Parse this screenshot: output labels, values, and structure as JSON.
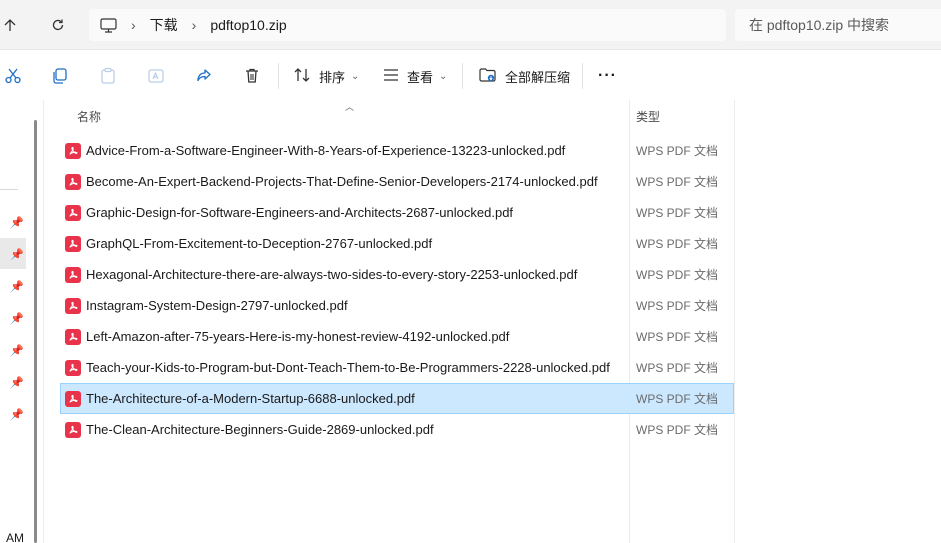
{
  "address": {
    "segments": [
      "下载",
      "pdftop10.zip"
    ]
  },
  "search": {
    "placeholder": "在 pdftop10.zip 中搜索"
  },
  "toolbar": {
    "sort_label": "排序",
    "view_label": "查看",
    "extract_all_label": "全部解压缩",
    "more_label": "···"
  },
  "header": {
    "name_label": "名称",
    "type_label": "类型"
  },
  "left_pane": {
    "partial_text": "AM"
  },
  "files": [
    {
      "name": "Advice-From-a-Software-Engineer-With-8-Years-of-Experience-13223-unlocked.pdf",
      "type": "WPS PDF 文档",
      "selected": false
    },
    {
      "name": "Become-An-Expert-Backend-Projects-That-Define-Senior-Developers-2174-unlocked.pdf",
      "type": "WPS PDF 文档",
      "selected": false
    },
    {
      "name": "Graphic-Design-for-Software-Engineers-and-Architects-2687-unlocked.pdf",
      "type": "WPS PDF 文档",
      "selected": false
    },
    {
      "name": "GraphQL-From-Excitement-to-Deception-2767-unlocked.pdf",
      "type": "WPS PDF 文档",
      "selected": false
    },
    {
      "name": "Hexagonal-Architecture-there-are-always-two-sides-to-every-story-2253-unlocked.pdf",
      "type": "WPS PDF 文档",
      "selected": false
    },
    {
      "name": "Instagram-System-Design-2797-unlocked.pdf",
      "type": "WPS PDF 文档",
      "selected": false
    },
    {
      "name": "Left-Amazon-after-75-years-Here-is-my-honest-review-4192-unlocked.pdf",
      "type": "WPS PDF 文档",
      "selected": false
    },
    {
      "name": "Teach-your-Kids-to-Program-but-Dont-Teach-Them-to-Be-Programmers-2228-unlocked.pdf",
      "type": "WPS PDF 文档",
      "selected": false
    },
    {
      "name": "The-Architecture-of-a-Modern-Startup-6688-unlocked.pdf",
      "type": "WPS PDF 文档",
      "selected": true
    },
    {
      "name": "The-Clean-Architecture-Beginners-Guide-2869-unlocked.pdf",
      "type": "WPS PDF 文档",
      "selected": false
    }
  ],
  "colors": {
    "selection_bg": "#cce8ff",
    "selection_border": "#99d1ff",
    "pdf_icon": "#e8334a"
  }
}
